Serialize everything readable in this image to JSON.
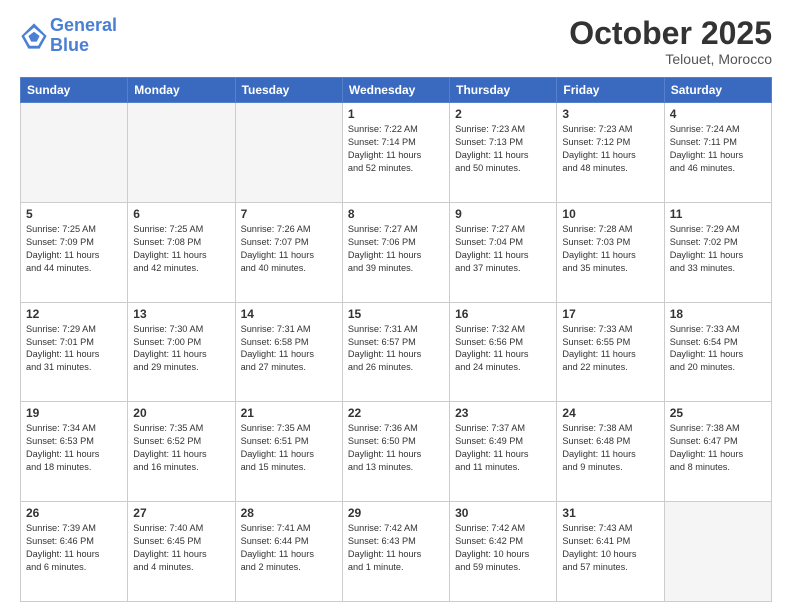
{
  "header": {
    "logo_line1": "General",
    "logo_line2": "Blue",
    "month": "October 2025",
    "location": "Telouet, Morocco"
  },
  "weekdays": [
    "Sunday",
    "Monday",
    "Tuesday",
    "Wednesday",
    "Thursday",
    "Friday",
    "Saturday"
  ],
  "weeks": [
    [
      {
        "day": "",
        "info": ""
      },
      {
        "day": "",
        "info": ""
      },
      {
        "day": "",
        "info": ""
      },
      {
        "day": "1",
        "info": "Sunrise: 7:22 AM\nSunset: 7:14 PM\nDaylight: 11 hours\nand 52 minutes."
      },
      {
        "day": "2",
        "info": "Sunrise: 7:23 AM\nSunset: 7:13 PM\nDaylight: 11 hours\nand 50 minutes."
      },
      {
        "day": "3",
        "info": "Sunrise: 7:23 AM\nSunset: 7:12 PM\nDaylight: 11 hours\nand 48 minutes."
      },
      {
        "day": "4",
        "info": "Sunrise: 7:24 AM\nSunset: 7:11 PM\nDaylight: 11 hours\nand 46 minutes."
      }
    ],
    [
      {
        "day": "5",
        "info": "Sunrise: 7:25 AM\nSunset: 7:09 PM\nDaylight: 11 hours\nand 44 minutes."
      },
      {
        "day": "6",
        "info": "Sunrise: 7:25 AM\nSunset: 7:08 PM\nDaylight: 11 hours\nand 42 minutes."
      },
      {
        "day": "7",
        "info": "Sunrise: 7:26 AM\nSunset: 7:07 PM\nDaylight: 11 hours\nand 40 minutes."
      },
      {
        "day": "8",
        "info": "Sunrise: 7:27 AM\nSunset: 7:06 PM\nDaylight: 11 hours\nand 39 minutes."
      },
      {
        "day": "9",
        "info": "Sunrise: 7:27 AM\nSunset: 7:04 PM\nDaylight: 11 hours\nand 37 minutes."
      },
      {
        "day": "10",
        "info": "Sunrise: 7:28 AM\nSunset: 7:03 PM\nDaylight: 11 hours\nand 35 minutes."
      },
      {
        "day": "11",
        "info": "Sunrise: 7:29 AM\nSunset: 7:02 PM\nDaylight: 11 hours\nand 33 minutes."
      }
    ],
    [
      {
        "day": "12",
        "info": "Sunrise: 7:29 AM\nSunset: 7:01 PM\nDaylight: 11 hours\nand 31 minutes."
      },
      {
        "day": "13",
        "info": "Sunrise: 7:30 AM\nSunset: 7:00 PM\nDaylight: 11 hours\nand 29 minutes."
      },
      {
        "day": "14",
        "info": "Sunrise: 7:31 AM\nSunset: 6:58 PM\nDaylight: 11 hours\nand 27 minutes."
      },
      {
        "day": "15",
        "info": "Sunrise: 7:31 AM\nSunset: 6:57 PM\nDaylight: 11 hours\nand 26 minutes."
      },
      {
        "day": "16",
        "info": "Sunrise: 7:32 AM\nSunset: 6:56 PM\nDaylight: 11 hours\nand 24 minutes."
      },
      {
        "day": "17",
        "info": "Sunrise: 7:33 AM\nSunset: 6:55 PM\nDaylight: 11 hours\nand 22 minutes."
      },
      {
        "day": "18",
        "info": "Sunrise: 7:33 AM\nSunset: 6:54 PM\nDaylight: 11 hours\nand 20 minutes."
      }
    ],
    [
      {
        "day": "19",
        "info": "Sunrise: 7:34 AM\nSunset: 6:53 PM\nDaylight: 11 hours\nand 18 minutes."
      },
      {
        "day": "20",
        "info": "Sunrise: 7:35 AM\nSunset: 6:52 PM\nDaylight: 11 hours\nand 16 minutes."
      },
      {
        "day": "21",
        "info": "Sunrise: 7:35 AM\nSunset: 6:51 PM\nDaylight: 11 hours\nand 15 minutes."
      },
      {
        "day": "22",
        "info": "Sunrise: 7:36 AM\nSunset: 6:50 PM\nDaylight: 11 hours\nand 13 minutes."
      },
      {
        "day": "23",
        "info": "Sunrise: 7:37 AM\nSunset: 6:49 PM\nDaylight: 11 hours\nand 11 minutes."
      },
      {
        "day": "24",
        "info": "Sunrise: 7:38 AM\nSunset: 6:48 PM\nDaylight: 11 hours\nand 9 minutes."
      },
      {
        "day": "25",
        "info": "Sunrise: 7:38 AM\nSunset: 6:47 PM\nDaylight: 11 hours\nand 8 minutes."
      }
    ],
    [
      {
        "day": "26",
        "info": "Sunrise: 7:39 AM\nSunset: 6:46 PM\nDaylight: 11 hours\nand 6 minutes."
      },
      {
        "day": "27",
        "info": "Sunrise: 7:40 AM\nSunset: 6:45 PM\nDaylight: 11 hours\nand 4 minutes."
      },
      {
        "day": "28",
        "info": "Sunrise: 7:41 AM\nSunset: 6:44 PM\nDaylight: 11 hours\nand 2 minutes."
      },
      {
        "day": "29",
        "info": "Sunrise: 7:42 AM\nSunset: 6:43 PM\nDaylight: 11 hours\nand 1 minute."
      },
      {
        "day": "30",
        "info": "Sunrise: 7:42 AM\nSunset: 6:42 PM\nDaylight: 10 hours\nand 59 minutes."
      },
      {
        "day": "31",
        "info": "Sunrise: 7:43 AM\nSunset: 6:41 PM\nDaylight: 10 hours\nand 57 minutes."
      },
      {
        "day": "",
        "info": ""
      }
    ]
  ]
}
